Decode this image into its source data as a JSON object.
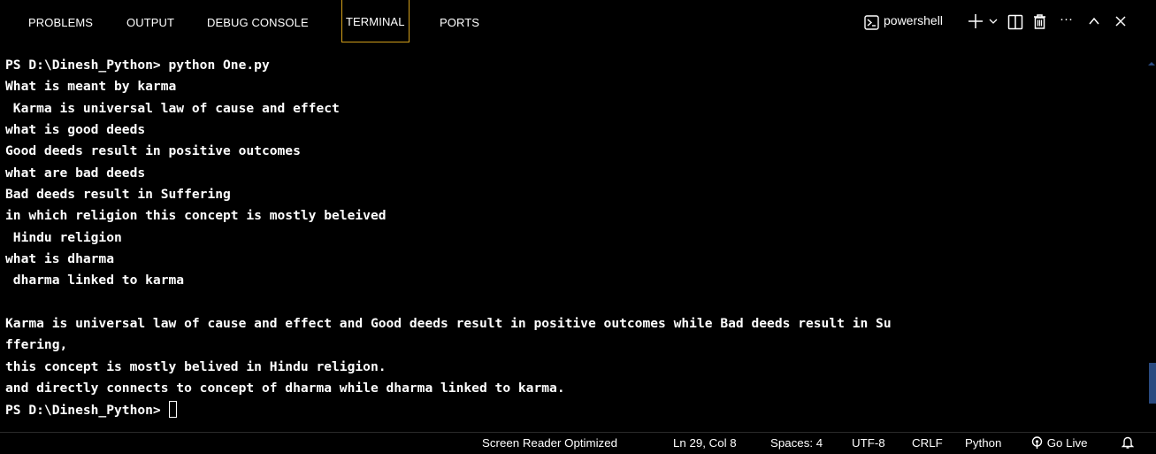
{
  "panel_tabs": [
    {
      "label": "PROBLEMS"
    },
    {
      "label": "OUTPUT"
    },
    {
      "label": "DEBUG CONSOLE"
    },
    {
      "label": "TERMINAL",
      "active": true
    },
    {
      "label": "PORTS"
    }
  ],
  "toolbar": {
    "shell_label": "powershell",
    "more_label": "···"
  },
  "terminal": {
    "lines": [
      "PS D:\\Dinesh_Python> python One.py",
      "What is meant by karma",
      " Karma is universal law of cause and effect",
      "what is good deeds",
      "Good deeds result in positive outcomes",
      "what are bad deeds",
      "Bad deeds result in Suffering",
      "in which religion this concept is mostly beleived",
      " Hindu religion",
      "what is dharma",
      " dharma linked to karma",
      "",
      "Karma is universal law of cause and effect and Good deeds result in positive outcomes while Bad deeds result in Su",
      "ffering,",
      "this concept is mostly belived in Hindu religion.",
      "and directly connects to concept of dharma while dharma linked to karma."
    ],
    "prompt": "PS D:\\Dinesh_Python> "
  },
  "statusbar": {
    "screen_reader": "Screen Reader Optimized",
    "position": "Ln 29, Col 8",
    "spaces": "Spaces: 4",
    "encoding": "UTF-8",
    "eol": "CRLF",
    "language": "Python",
    "go_live": "Go Live"
  },
  "colors": {
    "background": "#000000",
    "active_tab_border": "#d4a01a",
    "scrollbar_thumb": "#2a4a80"
  }
}
